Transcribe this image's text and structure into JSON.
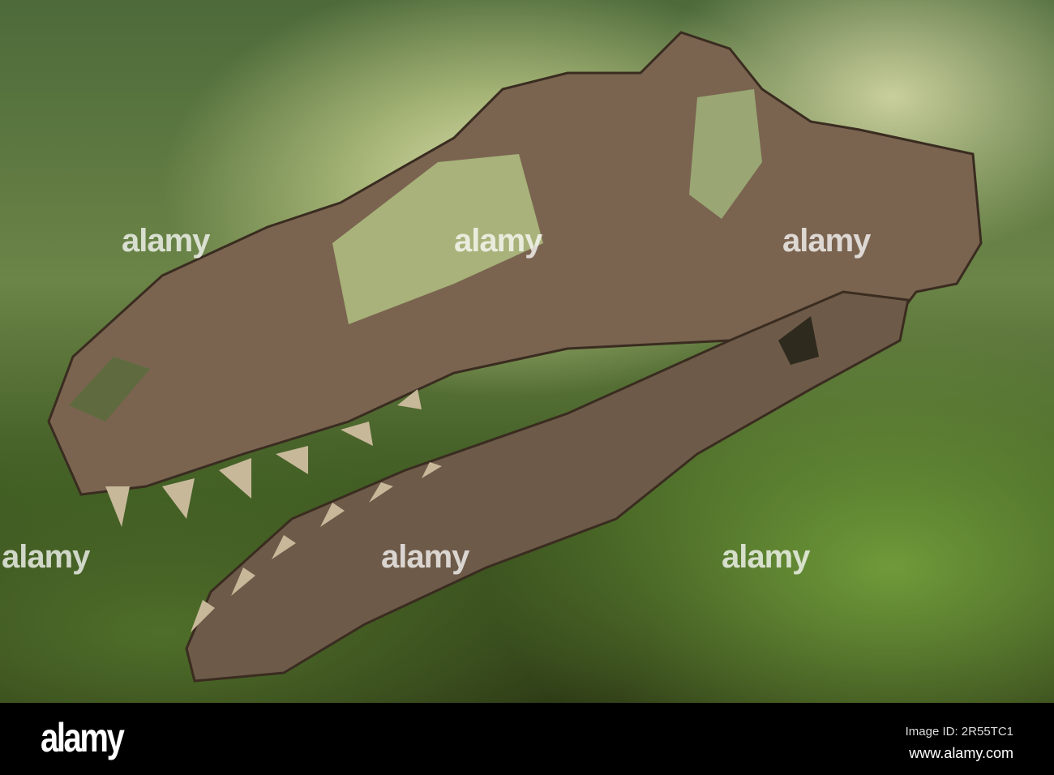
{
  "watermark": "alamy",
  "footer": {
    "logo": "alamy",
    "image_id": "Image ID: 2R55TC1",
    "website": "www.alamy.com"
  }
}
